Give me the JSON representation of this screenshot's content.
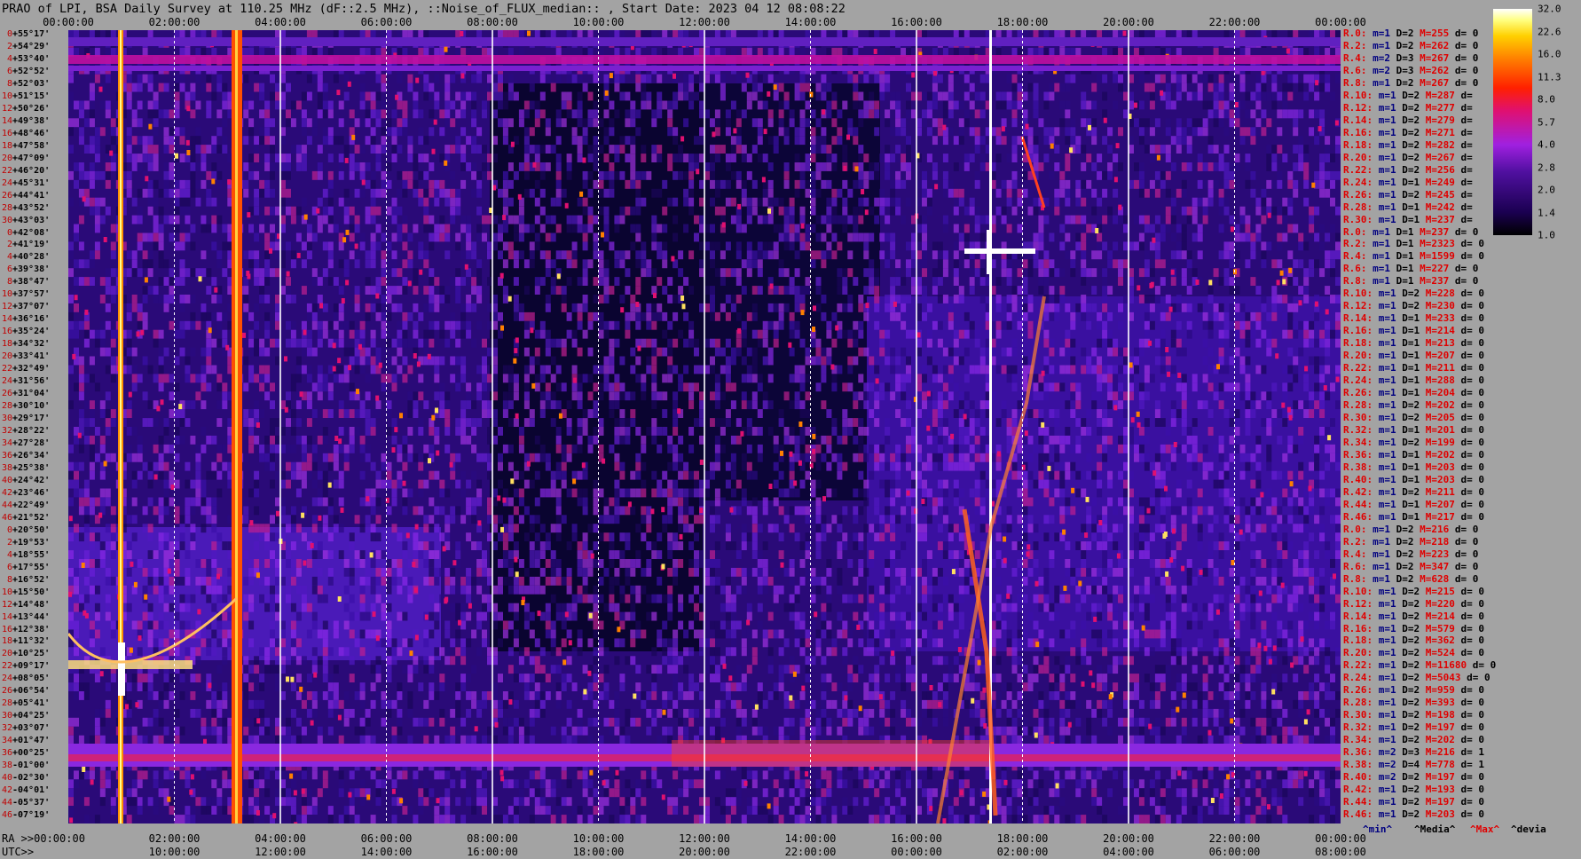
{
  "title": "PRAO of LPI, BSA Daily Survey at 110.25 MHz (dF::2.5 MHz), ::Noise_of_FLUX_median:: , Start Date: 2023 04 12 08:08:22",
  "top_axis": [
    "00:00:00",
    "02:00:00",
    "04:00:00",
    "06:00:00",
    "08:00:00",
    "10:00:00",
    "12:00:00",
    "14:00:00",
    "16:00:00",
    "18:00:00",
    "20:00:00",
    "22:00:00",
    "00:00:00"
  ],
  "ra_axis": [
    "02:00:00",
    "04:00:00",
    "06:00:00",
    "08:00:00",
    "10:00:00",
    "12:00:00",
    "14:00:00",
    "16:00:00",
    "18:00:00",
    "20:00:00",
    "22:00:00",
    "00:00:00"
  ],
  "ra_label": "RA >>00:00:00",
  "utc_label": "UTC>>",
  "utc_axis": [
    "10:00:00",
    "12:00:00",
    "14:00:00",
    "16:00:00",
    "18:00:00",
    "20:00:00",
    "22:00:00",
    "00:00:00",
    "02:00:00",
    "04:00:00",
    "06:00:00",
    "08:00:00"
  ],
  "declinations": [
    "+55°17'",
    "+54°29'",
    "+53°40'",
    "+52°52'",
    "+52°03'",
    "+51°15'",
    "+50°26'",
    "+49°38'",
    "+48°46'",
    "+47°58'",
    "+47°09'",
    "+46°20'",
    "+45°31'",
    "+44°41'",
    "+43°52'",
    "+43°03'",
    "+42°08'",
    "+41°19'",
    "+40°28'",
    "+39°38'",
    "+38°47'",
    "+37°57'",
    "+37°07'",
    "+36°16'",
    "+35°24'",
    "+34°32'",
    "+33°41'",
    "+32°49'",
    "+31°56'",
    "+31°04'",
    "+30°10'",
    "+29°17'",
    "+28°22'",
    "+27°28'",
    "+26°34'",
    "+25°38'",
    "+24°42'",
    "+23°46'",
    "+22°49'",
    "+21°52'",
    "+20°50'",
    "+19°53'",
    "+18°55'",
    "+17°55'",
    "+16°52'",
    "+15°50'",
    "+14°48'",
    "+13°44'",
    "+12°38'",
    "+11°32'",
    "+10°25'",
    "+09°17'",
    "+08°05'",
    "+06°54'",
    "+05°41'",
    "+04°25'",
    "+03°07'",
    "+01°47'",
    "+00°25'",
    "-01°00'",
    "-02°30'",
    "-04°01'",
    "-05°37'",
    "-07°19'"
  ],
  "channel_numbers": [
    "0",
    "2",
    "4",
    "6",
    "8",
    "10",
    "12",
    "14",
    "16",
    "18",
    "20",
    "22",
    "24",
    "26",
    "28",
    "30",
    "0",
    "2",
    "4",
    "6",
    "8",
    "10",
    "12",
    "14",
    "16",
    "18",
    "20",
    "22",
    "24",
    "26",
    "28",
    "30",
    "32",
    "34",
    "36",
    "38",
    "40",
    "42",
    "44",
    "46",
    "0",
    "2",
    "4",
    "6",
    "8",
    "10",
    "12",
    "14",
    "16",
    "18",
    "20",
    "22",
    "24",
    "26",
    "28",
    "30",
    "32",
    "34",
    "36",
    "38",
    "40",
    "42",
    "44",
    "46"
  ],
  "stats": [
    {
      "r": "R.0:",
      "m": "m=1",
      "d": "D=2",
      "M": "M=255",
      "dev": "d= 0"
    },
    {
      "r": "R.2:",
      "m": "m=1",
      "d": "D=2",
      "M": "M=262",
      "dev": "d= 0"
    },
    {
      "r": "R.4:",
      "m": "m=2",
      "d": "D=3",
      "M": "M=267",
      "dev": "d= 0"
    },
    {
      "r": "R.6:",
      "m": "m=2",
      "d": "D=3",
      "M": "M=262",
      "dev": "d= 0"
    },
    {
      "r": "R.8:",
      "m": "m=1",
      "d": "D=2",
      "M": "M=267",
      "dev": "d= 0"
    },
    {
      "r": "R.10:",
      "m": "m=1",
      "d": "D=2",
      "M": "M=287",
      "dev": "d="
    },
    {
      "r": "R.12:",
      "m": "m=1",
      "d": "D=2",
      "M": "M=277",
      "dev": "d="
    },
    {
      "r": "R.14:",
      "m": "m=1",
      "d": "D=2",
      "M": "M=279",
      "dev": "d="
    },
    {
      "r": "R.16:",
      "m": "m=1",
      "d": "D=2",
      "M": "M=271",
      "dev": "d="
    },
    {
      "r": "R.18:",
      "m": "m=1",
      "d": "D=2",
      "M": "M=282",
      "dev": "d="
    },
    {
      "r": "R.20:",
      "m": "m=1",
      "d": "D=2",
      "M": "M=267",
      "dev": "d="
    },
    {
      "r": "R.22:",
      "m": "m=1",
      "d": "D=2",
      "M": "M=256",
      "dev": "d="
    },
    {
      "r": "R.24:",
      "m": "m=1",
      "d": "D=1",
      "M": "M=249",
      "dev": "d="
    },
    {
      "r": "R.26:",
      "m": "m=1",
      "d": "D=2",
      "M": "M=245",
      "dev": "d="
    },
    {
      "r": "R.28:",
      "m": "m=1",
      "d": "D=1",
      "M": "M=242",
      "dev": "d="
    },
    {
      "r": "R.30:",
      "m": "m=1",
      "d": "D=1",
      "M": "M=237",
      "dev": "d="
    },
    {
      "r": "R.0:",
      "m": "m=1",
      "d": "D=1",
      "M": "M=237",
      "dev": "d= 0"
    },
    {
      "r": "R.2:",
      "m": "m=1",
      "d": "D=1",
      "M": "M=2323",
      "dev": "d= 0"
    },
    {
      "r": "R.4:",
      "m": "m=1",
      "d": "D=1",
      "M": "M=1599",
      "dev": "d= 0"
    },
    {
      "r": "R.6:",
      "m": "m=1",
      "d": "D=1",
      "M": "M=227",
      "dev": "d= 0"
    },
    {
      "r": "R.8:",
      "m": "m=1",
      "d": "D=1",
      "M": "M=237",
      "dev": "d= 0"
    },
    {
      "r": "R.10:",
      "m": "m=1",
      "d": "D=2",
      "M": "M=228",
      "dev": "d= 0"
    },
    {
      "r": "R.12:",
      "m": "m=1",
      "d": "D=2",
      "M": "M=230",
      "dev": "d= 0"
    },
    {
      "r": "R.14:",
      "m": "m=1",
      "d": "D=1",
      "M": "M=233",
      "dev": "d= 0"
    },
    {
      "r": "R.16:",
      "m": "m=1",
      "d": "D=1",
      "M": "M=214",
      "dev": "d= 0"
    },
    {
      "r": "R.18:",
      "m": "m=1",
      "d": "D=1",
      "M": "M=213",
      "dev": "d= 0"
    },
    {
      "r": "R.20:",
      "m": "m=1",
      "d": "D=1",
      "M": "M=207",
      "dev": "d= 0"
    },
    {
      "r": "R.22:",
      "m": "m=1",
      "d": "D=1",
      "M": "M=211",
      "dev": "d= 0"
    },
    {
      "r": "R.24:",
      "m": "m=1",
      "d": "D=1",
      "M": "M=288",
      "dev": "d= 0"
    },
    {
      "r": "R.26:",
      "m": "m=1",
      "d": "D=1",
      "M": "M=204",
      "dev": "d= 0"
    },
    {
      "r": "R.28:",
      "m": "m=1",
      "d": "D=2",
      "M": "M=202",
      "dev": "d= 0"
    },
    {
      "r": "R.30:",
      "m": "m=1",
      "d": "D=2",
      "M": "M=205",
      "dev": "d= 0"
    },
    {
      "r": "R.32:",
      "m": "m=1",
      "d": "D=1",
      "M": "M=201",
      "dev": "d= 0"
    },
    {
      "r": "R.34:",
      "m": "m=1",
      "d": "D=2",
      "M": "M=199",
      "dev": "d= 0"
    },
    {
      "r": "R.36:",
      "m": "m=1",
      "d": "D=1",
      "M": "M=202",
      "dev": "d= 0"
    },
    {
      "r": "R.38:",
      "m": "m=1",
      "d": "D=1",
      "M": "M=203",
      "dev": "d= 0"
    },
    {
      "r": "R.40:",
      "m": "m=1",
      "d": "D=1",
      "M": "M=203",
      "dev": "d= 0"
    },
    {
      "r": "R.42:",
      "m": "m=1",
      "d": "D=2",
      "M": "M=211",
      "dev": "d= 0"
    },
    {
      "r": "R.44:",
      "m": "m=1",
      "d": "D=1",
      "M": "M=207",
      "dev": "d= 0"
    },
    {
      "r": "R.46:",
      "m": "m=1",
      "d": "D=1",
      "M": "M=217",
      "dev": "d= 0"
    },
    {
      "r": "R.0:",
      "m": "m=1",
      "d": "D=2",
      "M": "M=216",
      "dev": "d= 0"
    },
    {
      "r": "R.2:",
      "m": "m=1",
      "d": "D=2",
      "M": "M=218",
      "dev": "d= 0"
    },
    {
      "r": "R.4:",
      "m": "m=1",
      "d": "D=2",
      "M": "M=223",
      "dev": "d= 0"
    },
    {
      "r": "R.6:",
      "m": "m=1",
      "d": "D=2",
      "M": "M=347",
      "dev": "d= 0"
    },
    {
      "r": "R.8:",
      "m": "m=1",
      "d": "D=2",
      "M": "M=628",
      "dev": "d= 0"
    },
    {
      "r": "R.10:",
      "m": "m=1",
      "d": "D=2",
      "M": "M=215",
      "dev": "d= 0"
    },
    {
      "r": "R.12:",
      "m": "m=1",
      "d": "D=2",
      "M": "M=220",
      "dev": "d= 0"
    },
    {
      "r": "R.14:",
      "m": "m=1",
      "d": "D=2",
      "M": "M=214",
      "dev": "d= 0"
    },
    {
      "r": "R.16:",
      "m": "m=1",
      "d": "D=2",
      "M": "M=579",
      "dev": "d= 0"
    },
    {
      "r": "R.18:",
      "m": "m=1",
      "d": "D=2",
      "M": "M=362",
      "dev": "d= 0"
    },
    {
      "r": "R.20:",
      "m": "m=1",
      "d": "D=2",
      "M": "M=524",
      "dev": "d= 0"
    },
    {
      "r": "R.22:",
      "m": "m=1",
      "d": "D=2",
      "M": "M=11680",
      "dev": "d= 0"
    },
    {
      "r": "R.24:",
      "m": "m=1",
      "d": "D=2",
      "M": "M=5043",
      "dev": "d= 0"
    },
    {
      "r": "R.26:",
      "m": "m=1",
      "d": "D=2",
      "M": "M=959",
      "dev": "d= 0"
    },
    {
      "r": "R.28:",
      "m": "m=1",
      "d": "D=2",
      "M": "M=393",
      "dev": "d= 0"
    },
    {
      "r": "R.30:",
      "m": "m=1",
      "d": "D=2",
      "M": "M=198",
      "dev": "d= 0"
    },
    {
      "r": "R.32:",
      "m": "m=1",
      "d": "D=2",
      "M": "M=197",
      "dev": "d= 0"
    },
    {
      "r": "R.34:",
      "m": "m=1",
      "d": "D=2",
      "M": "M=202",
      "dev": "d= 0"
    },
    {
      "r": "R.36:",
      "m": "m=2",
      "d": "D=3",
      "M": "M=216",
      "dev": "d= 1"
    },
    {
      "r": "R.38:",
      "m": "m=2",
      "d": "D=4",
      "M": "M=778",
      "dev": "d= 1"
    },
    {
      "r": "R.40:",
      "m": "m=2",
      "d": "D=2",
      "M": "M=197",
      "dev": "d= 0"
    },
    {
      "r": "R.42:",
      "m": "m=1",
      "d": "D=2",
      "M": "M=193",
      "dev": "d= 0"
    },
    {
      "r": "R.44:",
      "m": "m=1",
      "d": "D=2",
      "M": "M=197",
      "dev": "d= 0"
    },
    {
      "r": "R.46:",
      "m": "m=1",
      "d": "D=2",
      "M": "M=203",
      "dev": "d= 0"
    }
  ],
  "legend": {
    "min": "^min^",
    "median": "^Media^",
    "max": "^Max^",
    "devia": "^devia"
  },
  "colorbar": {
    "labels": [
      "32.0",
      "22.6",
      "16.0",
      "11.3",
      "8.0",
      "5.7",
      "4.0",
      "2.8",
      "2.0",
      "1.4",
      "1.0"
    ]
  },
  "colors": {
    "background": "#a3a3a3",
    "label_red": "#e00000",
    "label_navy": "#000080"
  }
}
